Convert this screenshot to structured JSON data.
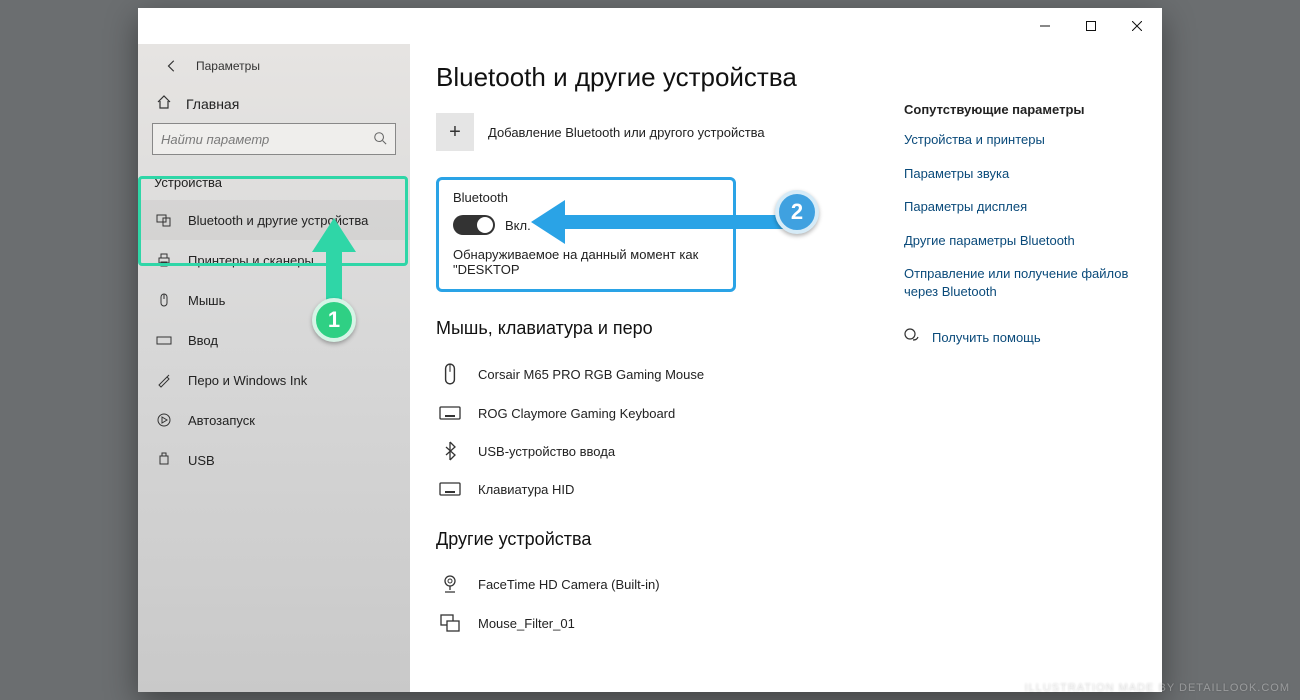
{
  "window": {
    "title": "Параметры"
  },
  "sidebar": {
    "home": "Главная",
    "search_placeholder": "Найти параметр",
    "section": "Устройства",
    "items": [
      {
        "label": "Bluetooth и другие устройства"
      },
      {
        "label": "Принтеры и сканеры"
      },
      {
        "label": "Мышь"
      },
      {
        "label": "Ввод"
      },
      {
        "label": "Перо и Windows Ink"
      },
      {
        "label": "Автозапуск"
      },
      {
        "label": "USB"
      }
    ]
  },
  "page": {
    "title": "Bluetooth и другие устройства",
    "add_device": "Добавление Bluetooth или другого устройства",
    "bt_label": "Bluetooth",
    "bt_state": "Вкл.",
    "discoverable": "Обнаруживаемое на данный момент как \"DESKTOP",
    "section_mkp": "Мышь, клавиатура и перо",
    "devices_mkp": [
      {
        "name": "Corsair M65 PRO RGB Gaming Mouse",
        "icon": "mouse"
      },
      {
        "name": "ROG Claymore Gaming Keyboard",
        "icon": "keyboard"
      },
      {
        "name": "USB-устройство ввода",
        "icon": "bluetooth"
      },
      {
        "name": "Клавиатура HID",
        "icon": "keyboard"
      }
    ],
    "section_other": "Другие устройства",
    "devices_other": [
      {
        "name": "FaceTime HD Camera (Built-in)",
        "icon": "camera"
      },
      {
        "name": "Mouse_Filter_01",
        "icon": "generic"
      }
    ]
  },
  "right": {
    "header": "Сопутствующие параметры",
    "links": [
      "Устройства и принтеры",
      "Параметры звука",
      "Параметры дисплея",
      "Другие параметры Bluetooth",
      "Отправление или получение файлов через Bluetooth"
    ],
    "help": "Получить помощь"
  },
  "annotations": {
    "badge1": "1",
    "badge2": "2"
  },
  "watermark": "ILLUSTRATION MADE BY DETAILLOOK.COM"
}
